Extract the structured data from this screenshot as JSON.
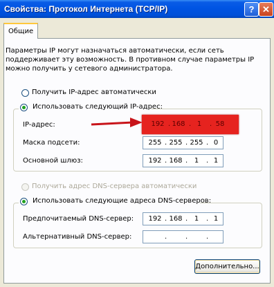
{
  "window": {
    "title": "Свойства: Протокол Интернета (TCP/IP)",
    "help_label": "?",
    "close_label": "✕"
  },
  "tabs": [
    {
      "label": "Общие",
      "active": true
    }
  ],
  "intro_text": "Параметры IP могут назначаться автоматически, если сеть поддерживает эту возможность. В противном случае параметры IP можно получить у сетевого администратора.",
  "ip_mode": {
    "auto_label": "Получить IP-адрес автоматически",
    "auto_checked": false,
    "manual_label": "Использовать следующий IP-адрес:",
    "manual_checked": true
  },
  "ip_fields": {
    "ip_address": {
      "label": "IP-адрес:",
      "octets": [
        "192",
        "168",
        "1",
        "58"
      ],
      "highlighted": true
    },
    "subnet_mask": {
      "label": "Маска подсети:",
      "octets": [
        "255",
        "255",
        "255",
        "0"
      ]
    },
    "gateway": {
      "label": "Основной шлюз:",
      "octets": [
        "192",
        "168",
        "1",
        "1"
      ]
    }
  },
  "dns_mode": {
    "auto_label": "Получить адрес DNS-сервера автоматически",
    "auto_checked": false,
    "auto_disabled": true,
    "manual_label": "Использовать следующие адреса DNS-серверов:",
    "manual_checked": true
  },
  "dns_fields": {
    "preferred": {
      "label": "Предпочитаемый DNS-сервер:",
      "octets": [
        "192",
        "168",
        "1",
        "1"
      ]
    },
    "alternate": {
      "label": "Альтернативный DNS-сервер:",
      "octets": [
        "",
        "",
        "",
        ""
      ]
    }
  },
  "buttons": {
    "advanced_label": "Дополнительно..."
  },
  "colors": {
    "titlebar": "#0054e3",
    "highlight": "#e6231f",
    "arrow": "#c8141a",
    "radio_dot": "#21a121"
  }
}
